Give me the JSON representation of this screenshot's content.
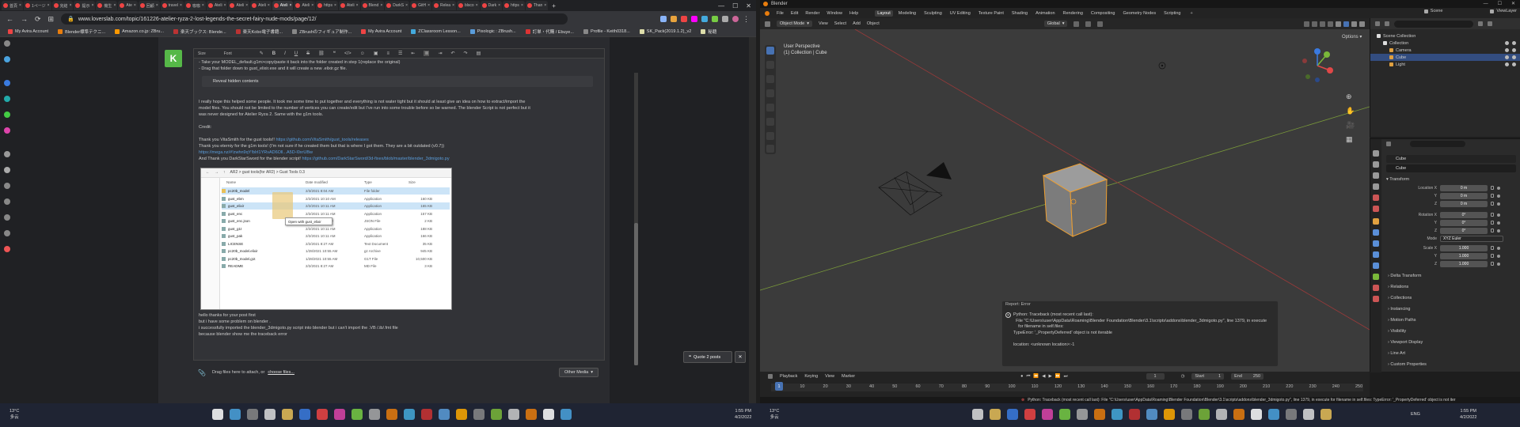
{
  "browser": {
    "tabs": [
      {
        "label": "首頁",
        "active": false
      },
      {
        "label": "1ページ",
        "active": false
      },
      {
        "label": "完結",
        "active": false
      },
      {
        "label": "提示",
        "active": false
      },
      {
        "label": "機生",
        "active": false
      },
      {
        "label": "Ate",
        "active": false
      },
      {
        "label": "回顧",
        "active": false
      },
      {
        "label": "travel",
        "active": false
      },
      {
        "label": "咖咖",
        "active": false
      },
      {
        "label": "Ateli",
        "active": false
      },
      {
        "label": "Ateli",
        "active": false
      },
      {
        "label": "Ateli",
        "active": false
      },
      {
        "label": "Ateli",
        "active": true
      },
      {
        "label": "Ateli",
        "active": false
      },
      {
        "label": "https",
        "active": false
      },
      {
        "label": "Ateli",
        "active": false
      },
      {
        "label": "Blend",
        "active": false
      },
      {
        "label": "DarkS",
        "active": false
      },
      {
        "label": "GitH",
        "active": false
      },
      {
        "label": "Relea",
        "active": false
      },
      {
        "label": "blsco",
        "active": false
      },
      {
        "label": "Dark",
        "active": false
      },
      {
        "label": "https",
        "active": false
      },
      {
        "label": "Than",
        "active": false
      }
    ],
    "new_tab": "+",
    "url": "www.loverslab.com/topic/161226-atelier-ryza-2-lost-legends-the-secret-fairy-nude-mods/page/12/",
    "bookmarks": [
      "My Avira Account",
      "Blender標準テクニ...",
      "Amazon.co.jp: ZBru...",
      "楽天ブックス: Blende...",
      "楽天Kobo電子書籍...",
      "ZBrushのフィギュア制作...",
      "My Avira Account",
      "ZClassroom Lesson...",
      "Pixologic : ZBrush...",
      "訂単・代購 / Ebuye...",
      "Profile - Keith0318...",
      "SK_Pack(2019.1.2)_v2",
      "秘籍"
    ],
    "editor": {
      "toolbar": {
        "style": "Size",
        "font": "Font"
      },
      "lines": [
        "- Take your MODEL_default.g1m>copy/paste it back into the folder created in step 1(replace the original)",
        "   - Drag that folder down to gust_elixir.exe and it will create a new .elixir.gz file.",
        "I really hope this helped some people. It took me some time to put together and everything is not water tight but it should at least give an idea on how to extract/import the",
        "model files. You should not be limited to the number of vertices you can create/edit but I've run into some trouble before so be warned. The blender Script is not perfect but it",
        "was never designed for Atelier Ryza 2. Same with the g1m tools.",
        "Credit:",
        "Thank you VitaSmith for the gust tools!!",
        "Thank you eterniy for the g1m tools! (I'm not sure if he created them but that is where I got them. They are a bit outdated (v0.7))",
        "And Thank you DarkStarSword for the blender script!"
      ],
      "reveal_label": "Reveal hidden contents",
      "links": {
        "gust_tools": "https://github.com/VitaSmith/gust_tools/releases",
        "mega": "https://mega.nz/#!zwhn9qY!bIrl1YRvAD6Oll...A5D-l0xrUBw",
        "blender_script": "https://github.com/DarkStarSword/3d-fixes/blob/master/blender_3dmigoto.py"
      },
      "screenshot": {
        "path": "AR2  >  gust tools(for AR2)  >  Gust Tools 0.3",
        "headers": [
          "Name",
          "Date modified",
          "Type",
          "Size"
        ],
        "files": [
          {
            "name": "pc20b_model",
            "date": "2/3/2021 8:04 AM",
            "type": "File folder",
            "size": "",
            "sel": true
          },
          {
            "name": "gust_ebm",
            "date": "2/2/2021 10:10 AM",
            "type": "Application",
            "size": "160 KB",
            "sel": false
          },
          {
            "name": "gust_elixir",
            "date": "2/2/2021 10:11 AM",
            "type": "Application",
            "size": "165 KB",
            "sel": true
          },
          {
            "name": "gust_enc",
            "date": "2/2/2021 10:11 AM",
            "type": "Application",
            "size": "157 KB",
            "sel": false
          },
          {
            "name": "gust_enc.json",
            "date": "2/2/2021 8:27 AM",
            "type": "JSON File",
            "size": "2 KB",
            "sel": false
          },
          {
            "name": "gust_g1t",
            "date": "2/2/2021 10:11 AM",
            "type": "Application",
            "size": "188 KB",
            "sel": false
          },
          {
            "name": "gust_pak",
            "date": "2/2/2021 10:11 AM",
            "type": "Application",
            "size": "166 KB",
            "sel": false
          },
          {
            "name": "LICENSE",
            "date": "2/2/2021 8:27 AM",
            "type": "Text Document",
            "size": "35 KB",
            "sel": false
          },
          {
            "name": "pc20b_model.elixir",
            "date": "1/28/2021 10:55 AM",
            "type": "gz Archive",
            "size": "945 KB",
            "sel": false
          },
          {
            "name": "pc20b_model.g1t",
            "date": "1/28/2021 10:55 AM",
            "type": "G1T File",
            "size": "10,500 KB",
            "sel": false
          },
          {
            "name": "README",
            "date": "2/2/2021 8:27 AM",
            "type": "MD File",
            "size": "3 KB",
            "sel": false
          }
        ],
        "context_menu": "Open with gust_elixir"
      },
      "reply_lines": [
        "hello thanks for your post first",
        "but i have some problem on blender .",
        " i successfully imported the blender_3dmigoto.py script into blender but i can't import the .VB /.ib/.fmt file",
        "because blender show me the traceback error"
      ]
    },
    "avatar_letter": "K",
    "attach_label": "Drag files here to attach, or",
    "attach_link": "choose files...",
    "other_media": "Other Media",
    "quote_label": "Quote 2 posts"
  },
  "blender": {
    "title": "Blender",
    "menus": [
      "File",
      "Edit",
      "Render",
      "Window",
      "Help"
    ],
    "workspaces": [
      "Layout",
      "Modeling",
      "Sculpting",
      "UV Editing",
      "Texture Paint",
      "Shading",
      "Animation",
      "Rendering",
      "Compositing",
      "Geometry Nodes",
      "Scripting"
    ],
    "active_workspace": "Layout",
    "scene": "Scene",
    "view_layer": "ViewLayer",
    "viewport_header": {
      "mode": "Object Mode",
      "items": [
        "View",
        "Select",
        "Add",
        "Object"
      ],
      "orientation": "Global"
    },
    "viewport_info": [
      "User Perspective",
      "(1) Collection | Cube"
    ],
    "options_label": "Options",
    "outliner": {
      "rows": [
        {
          "label": "Scene Collection",
          "indent": 0,
          "sel": false,
          "color": "#ddd"
        },
        {
          "label": "Collection",
          "indent": 1,
          "sel": false,
          "color": "#ddd"
        },
        {
          "label": "Camera",
          "indent": 2,
          "sel": false,
          "color": "#e0a040"
        },
        {
          "label": "Cube",
          "indent": 2,
          "sel": true,
          "color": "#e0a040"
        },
        {
          "label": "Light",
          "indent": 2,
          "sel": false,
          "color": "#e0a040"
        }
      ]
    },
    "properties": {
      "object_name": "Cube",
      "object_name2": "Cube",
      "transform_label": "Transform",
      "location": [
        {
          "axis": "Location X",
          "val": "0 m"
        },
        {
          "axis": "Y",
          "val": "0 m"
        },
        {
          "axis": "Z",
          "val": "0 m"
        }
      ],
      "rotation": [
        {
          "axis": "Rotation X",
          "val": "0°"
        },
        {
          "axis": "Y",
          "val": "0°"
        },
        {
          "axis": "Z",
          "val": "0°"
        }
      ],
      "mode": {
        "axis": "Mode",
        "val": "XYZ Euler"
      },
      "scale": [
        {
          "axis": "Scale X",
          "val": "1.000"
        },
        {
          "axis": "Y",
          "val": "1.000"
        },
        {
          "axis": "Z",
          "val": "1.000"
        }
      ],
      "subpanels": [
        "Delta Transform",
        "Relations",
        "Collections",
        "Instancing",
        "Motion Paths",
        "Visibility",
        "Viewport Display",
        "Line Art",
        "Custom Properties"
      ]
    },
    "error": {
      "title": "Report: Error",
      "body": "Python: Traceback (most recent call last):\n  File \"C:\\Users\\user\\AppData\\Roaming\\Blender Foundation\\Blender\\3.1\\scripts\\addons\\blender_3dmigoto.py\", line 1379, in execute\n    for filename in self.files:\nTypeError: '_PropertyDeferred' object is not iterable\n\nlocation: <unknown location>:-1"
    },
    "timeline": {
      "menus": [
        "Playback",
        "Keying",
        "View",
        "Marker"
      ],
      "current": "1",
      "start_label": "Start",
      "start": "1",
      "end_label": "End",
      "end": "250",
      "ticks": [
        "1",
        "10",
        "20",
        "30",
        "40",
        "50",
        "60",
        "70",
        "80",
        "90",
        "100",
        "110",
        "120",
        "130",
        "140",
        "150",
        "160",
        "170",
        "180",
        "190",
        "200",
        "210",
        "220",
        "230",
        "240",
        "250"
      ]
    },
    "status": "Python: Traceback (most recent call last):  File \"C:\\Users\\user\\AppData\\Roaming\\Blender Foundation\\Blender\\3.1\\scripts\\addons\\blender_3dmigoto.py\", line 1379, in execute    for filename in self.files: TypeError: '_PropertyDeferred' object is not iter"
  },
  "taskbar": {
    "weather_left": {
      "temp": "13°C",
      "cond": "多云"
    },
    "weather_right": {
      "temp": "13°C",
      "cond": "多云"
    },
    "clock_left": {
      "time": "1:55 PM",
      "date": "4/2/2022"
    },
    "clock_right": {
      "time": "1:55 PM",
      "date": "4/2/2022"
    },
    "lang": "ENG"
  },
  "colors": {
    "accent": "#4772b3",
    "selection": "#334d80",
    "link": "#5a9ddb",
    "cube_outline": "#f0a030"
  }
}
